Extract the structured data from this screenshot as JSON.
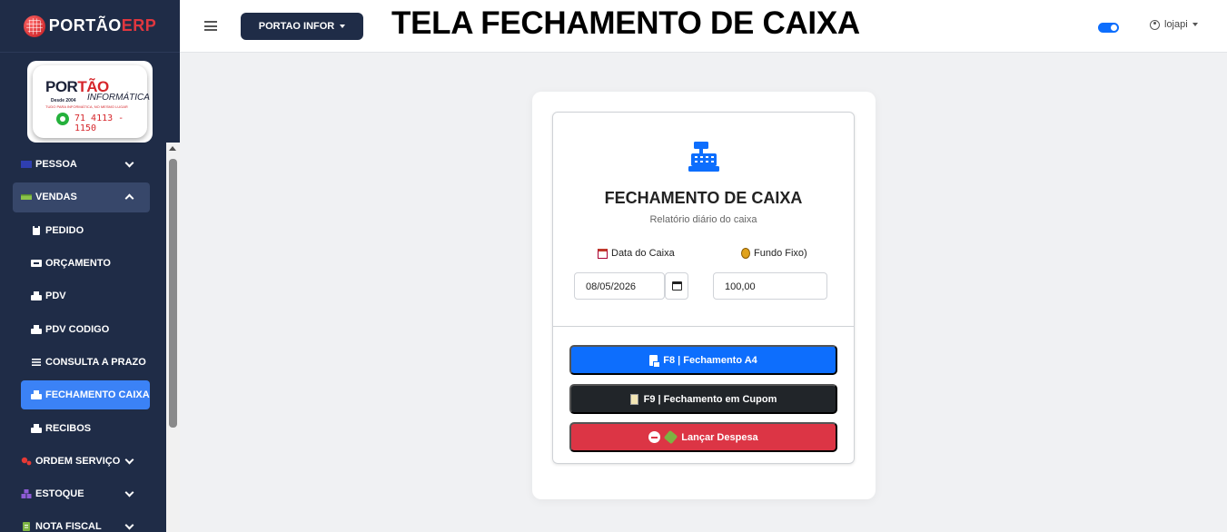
{
  "brand": {
    "name_part1": "PORTÃO",
    "name_part2": "ERP"
  },
  "logo": {
    "word_part1": "POR",
    "word_part2": "TÃO",
    "tagline": "Desde 2004",
    "informatica": "INFORMÁTICA",
    "slogan": "TUDO PARA INFORMÁTICA, NO MESMO LUGAR",
    "phone": "71 4113 - 1150"
  },
  "sidebar": {
    "items": [
      {
        "label": "PESSOA",
        "level": "top",
        "icon": "people-icon",
        "chevron": "down"
      },
      {
        "label": "VENDAS",
        "level": "top",
        "icon": "cash-icon",
        "chevron": "up",
        "open": true
      },
      {
        "label": "PEDIDO",
        "level": "sub",
        "icon": "clipboard-icon"
      },
      {
        "label": "ORÇAMENTO",
        "level": "sub",
        "icon": "ad-icon"
      },
      {
        "label": "PDV",
        "level": "sub",
        "icon": "printer-icon"
      },
      {
        "label": "PDV CODIGO",
        "level": "sub",
        "icon": "printer-icon"
      },
      {
        "label": "CONSULTA A PRAZO",
        "level": "sub",
        "icon": "list-icon"
      },
      {
        "label": "FECHAMENTO CAIXA",
        "level": "sub",
        "icon": "printer-icon",
        "active": true
      },
      {
        "label": "RECIBOS",
        "level": "sub",
        "icon": "printer-icon"
      },
      {
        "label": "ORDEM SERVIÇO",
        "level": "top",
        "icon": "gears-icon",
        "chevron": "down"
      },
      {
        "label": "ESTOQUE",
        "level": "top",
        "icon": "boxes-icon",
        "chevron": "down"
      },
      {
        "label": "NOTA FISCAL",
        "level": "top",
        "icon": "document-icon",
        "chevron": "down"
      }
    ]
  },
  "header": {
    "company": "PORTAO INFOR",
    "title": "TELA FECHAMENTO DE CAIXA",
    "user": "lojapi"
  },
  "card": {
    "title": "FECHAMENTO DE CAIXA",
    "subtitle": "Relatório diário do caixa",
    "date_label": "Data do Caixa",
    "fund_label": "Fundo Fixo)",
    "date_value": "08/05/2026",
    "fund_value": "100,00"
  },
  "buttons": {
    "a4": "F8 | Fechamento A4",
    "cupom": "F9 | Fechamento em Cupom",
    "despesa": "Lançar Despesa"
  },
  "colors": {
    "sidebar_bg": "#1f2c47",
    "primary": "#0d6efd",
    "dark": "#212529",
    "danger": "#dc3545",
    "active_item": "#3b82f6"
  }
}
